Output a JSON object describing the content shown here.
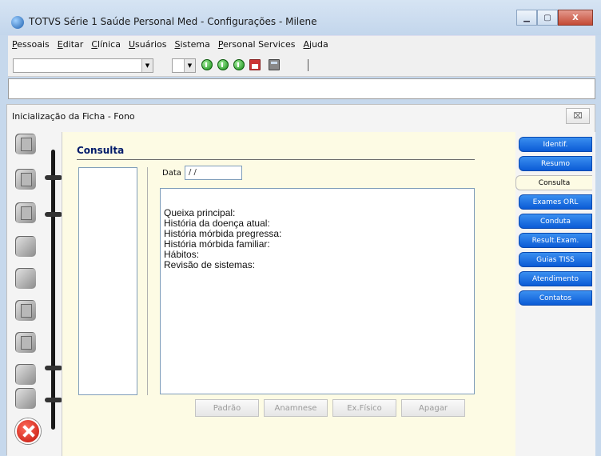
{
  "app": {
    "title": "TOTVS Série 1 Saúde Personal Med - Configurações - Milene"
  },
  "window_controls": {
    "minimize": "▁",
    "maximize": "▢",
    "close": "X"
  },
  "menu": [
    "Pessoais",
    "Editar",
    "Clínica",
    "Usuários",
    "Sistema",
    "Personal Services",
    "Ajuda"
  ],
  "toolbar": {
    "combo1_value": "",
    "combo2_value": "",
    "dropdown_glyph": "▼",
    "icons": [
      "go-icon",
      "back-icon",
      "forward-icon",
      "calendar-icon",
      "calculator-icon"
    ]
  },
  "dialog": {
    "title": "Inicialização da Ficha - Fono",
    "close_glyph": "⌧"
  },
  "consulta": {
    "section_title": "Consulta",
    "date_label": "Data",
    "date_value": " / /",
    "lines": [
      "Queixa principal:",
      "História da doença atual:",
      "História mórbida pregressa:",
      "História mórbida familiar:",
      "Hábitos:",
      "Revisão de sistemas:"
    ],
    "buttons": [
      "Padrão",
      "Anamnese",
      "Ex.Físico",
      "Apagar"
    ]
  },
  "tabs": [
    {
      "label": "Identif.",
      "active": false
    },
    {
      "label": "Resumo",
      "active": false
    },
    {
      "label": "Consulta",
      "active": true
    },
    {
      "label": "Exames ORL",
      "active": false
    },
    {
      "label": "Conduta",
      "active": false
    },
    {
      "label": "Result.Exam.",
      "active": false
    },
    {
      "label": "Guias TISS",
      "active": false
    },
    {
      "label": "Atendimento",
      "active": false
    },
    {
      "label": "Contatos",
      "active": false
    }
  ],
  "left_icons": [
    "notebook-icon",
    "book-icon",
    "building-icon",
    "megaphone-icon",
    "gear-icon",
    "folder-icon",
    "document-icon",
    "disc-icon",
    "tools-icon"
  ],
  "colors": {
    "tab_blue": "#0b5bd6",
    "card_bg": "#fdfbe4",
    "section_title": "#001a6a",
    "stop_red": "#c0140a"
  }
}
